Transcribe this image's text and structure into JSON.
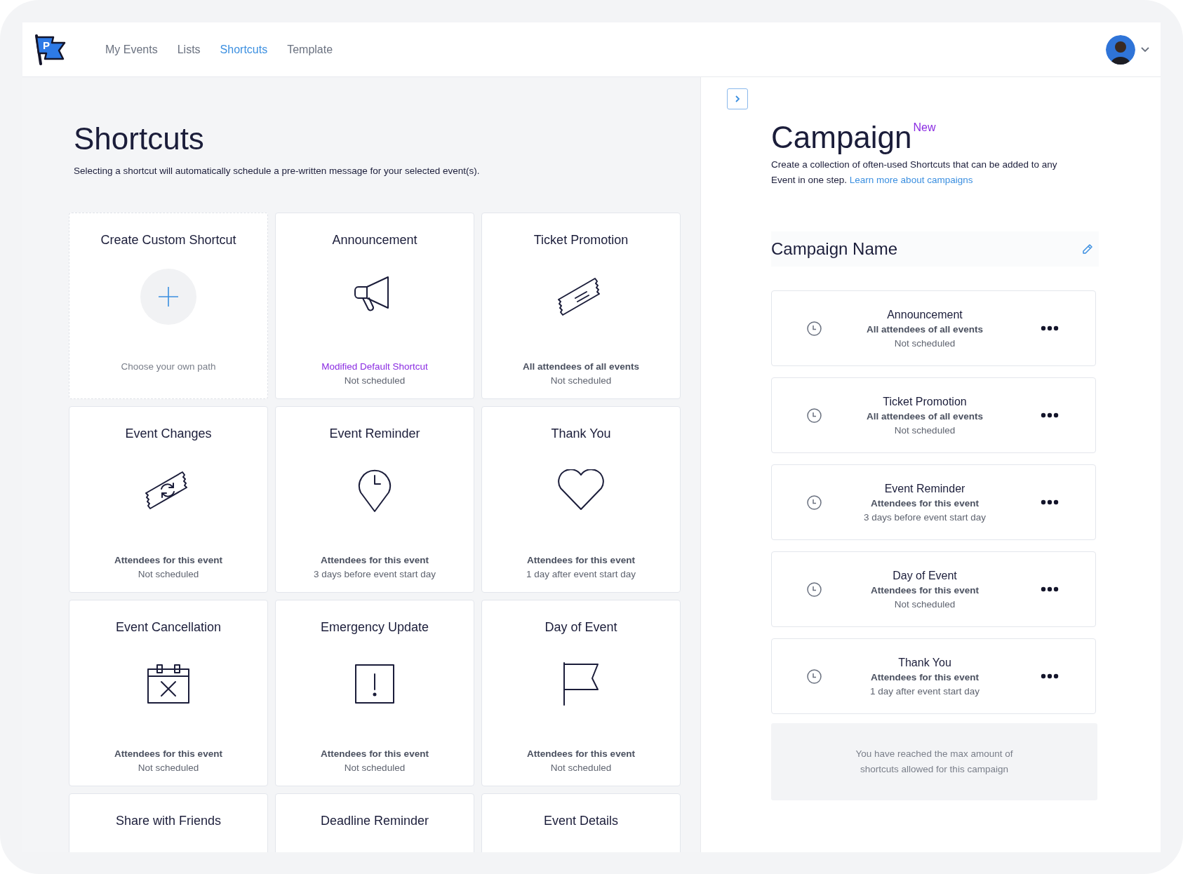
{
  "nav": {
    "logo_text": "P",
    "links": [
      {
        "label": "My Events",
        "selected": false
      },
      {
        "label": "Lists",
        "selected": false
      },
      {
        "label": "Shortcuts",
        "selected": true
      },
      {
        "label": "Template",
        "selected": false
      }
    ]
  },
  "shortcuts": {
    "title": "Shortcuts",
    "description": "Selecting a shortcut will automatically schedule a pre-written message for your selected event(s).",
    "cards": [
      {
        "kind": "custom",
        "title": "Create Custom Shortcut",
        "hint": "Choose your own path"
      },
      {
        "kind": "shortcut",
        "title": "Announcement",
        "audience": "Modified Default Shortcut",
        "modified": true,
        "schedule": "Not scheduled"
      },
      {
        "kind": "shortcut",
        "title": "Ticket Promotion",
        "audience": "All attendees of all events",
        "modified": false,
        "schedule": "Not scheduled"
      },
      {
        "kind": "shortcut",
        "title": "Event Changes",
        "audience": "Attendees for this event",
        "modified": false,
        "schedule": "Not scheduled"
      },
      {
        "kind": "shortcut",
        "title": "Event Reminder",
        "audience": "Attendees for this event",
        "modified": false,
        "schedule": "3 days before event start day"
      },
      {
        "kind": "shortcut",
        "title": "Thank You",
        "audience": "Attendees for this event",
        "modified": false,
        "schedule": "1 day after event start day"
      },
      {
        "kind": "shortcut",
        "title": "Event Cancellation",
        "audience": "Attendees for this event",
        "modified": false,
        "schedule": "Not scheduled"
      },
      {
        "kind": "shortcut",
        "title": "Emergency Update",
        "audience": "Attendees for this event",
        "modified": false,
        "schedule": "Not scheduled"
      },
      {
        "kind": "shortcut",
        "title": "Day of Event",
        "audience": "Attendees for this event",
        "modified": false,
        "schedule": "Not scheduled"
      },
      {
        "kind": "shortcut",
        "title": "Share with Friends"
      },
      {
        "kind": "shortcut",
        "title": "Deadline Reminder"
      },
      {
        "kind": "shortcut",
        "title": "Event Details"
      }
    ]
  },
  "campaign": {
    "title": "Campaign",
    "badge": "New",
    "description": "Create a collection of often-used Shortcuts that can be added to any Event in one step.",
    "link": "Learn more about campaigns",
    "name": "Campaign Name",
    "items": [
      {
        "title": "Announcement",
        "audience": "All attendees of all events",
        "schedule": "Not scheduled"
      },
      {
        "title": "Ticket Promotion",
        "audience": "All attendees of all events",
        "schedule": "Not scheduled"
      },
      {
        "title": "Event Reminder",
        "audience": "Attendees for this event",
        "schedule": "3 days before event start day"
      },
      {
        "title": "Day of Event",
        "audience": "Attendees for this event",
        "schedule": "Not scheduled"
      },
      {
        "title": "Thank You",
        "audience": "Attendees for this event",
        "schedule": "1 day after event start day"
      }
    ],
    "notice": "You have reached the max amount of shortcuts allowed for this campaign"
  }
}
